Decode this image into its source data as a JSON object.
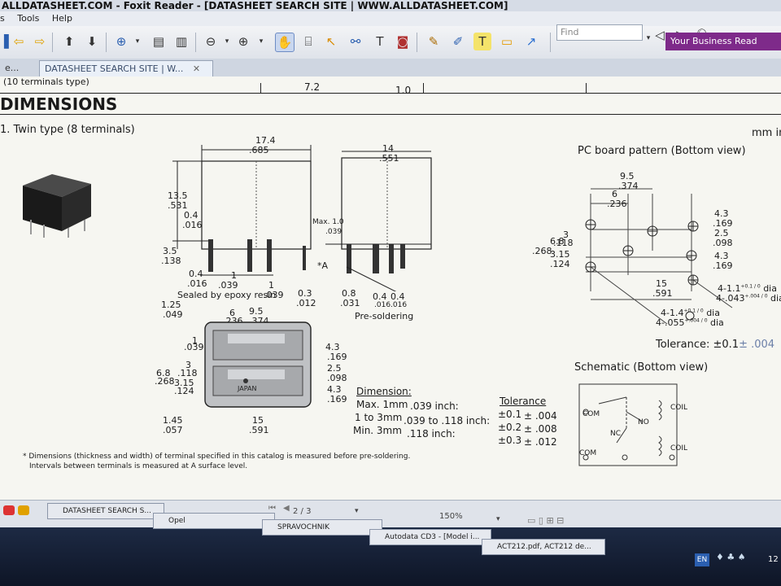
{
  "window": {
    "title": "ALLDATASHEET.COM - Foxit Reader - [DATASHEET SEARCH SITE | WWW.ALLDATASHEET.COM]"
  },
  "menu": {
    "items": [
      "s",
      "Tools",
      "Help"
    ]
  },
  "toolbar": {
    "ad_text": "Your Business Read",
    "find_placeholder": "Find"
  },
  "tabs": [
    {
      "label": "e...",
      "active": false
    },
    {
      "label": "DATASHEET SEARCH SITE | W...",
      "active": true,
      "close": "✕"
    }
  ],
  "document": {
    "table_row": {
      "left": "(10 terminals type)",
      "mid": "7.2",
      "right": "1.0"
    },
    "section_title": "DIMENSIONS",
    "subsection": "1. Twin type (8 terminals)",
    "unit": "mm in",
    "front_view": {
      "width_mm": "17.4",
      "width_in": ".685",
      "height_mm": "13.5",
      "height_in": ".531",
      "d04_mm": "0.4",
      "d04_in": ".016",
      "d35_mm": "3.5",
      "d35_in": ".138",
      "pin_w_mm": "0.4",
      "pin_w_in": ".016",
      "pitch1_mm": "1",
      "pitch1_in": ".039",
      "pitch2_mm": "1",
      "pitch2_in": ".039"
    },
    "side_view": {
      "width_mm": "14",
      "width_in": ".551",
      "max_label": "Max. 1.0",
      "max_in": ".039",
      "a_label": "*A",
      "d03_mm": "0.3",
      "d03_in": ".012",
      "d08_mm": "0.8",
      "d08_in": ".031",
      "d04a_mm": "0.4",
      "d04a_in": ".016",
      "d04b_mm": "0.4",
      "d04b_in": ".016",
      "presolder": "Pre-soldering"
    },
    "bottom_view": {
      "sealed": "Sealed by epoxy resin",
      "d125_mm": "1.25",
      "d125_in": ".049",
      "d6_mm": "6",
      "d6_in": ".236",
      "d95_mm": "9.5",
      "d95_in": ".374",
      "d1_mm": "1",
      "d1_in": ".039",
      "d3_mm": "3",
      "d3_in": ".118",
      "d68_mm": "6.8",
      "d68_in": ".268",
      "d315_mm": "3.15",
      "d315_in": ".124",
      "d43_mm": "4.3",
      "d43_in": ".169",
      "d25_mm": "2.5",
      "d25_in": ".098",
      "d43b_mm": "4.3",
      "d43b_in": ".169",
      "d145_mm": "1.45",
      "d145_in": ".057",
      "d15_mm": "15",
      "d15_in": ".591",
      "japan": "JAPAN"
    },
    "dimension_table": {
      "title": "Dimension:",
      "rows": [
        {
          "label": "Max. 1mm",
          "inch": ".039 inch:"
        },
        {
          "label": "1 to 3mm",
          "inch": ".039 to .118 inch:"
        },
        {
          "label": "Min. 3mm",
          "inch": ".118 inch:"
        }
      ]
    },
    "tolerance_table": {
      "title": "Tolerance",
      "rows": [
        {
          "mm": "±0.1",
          "in": "± .004"
        },
        {
          "mm": "±0.2",
          "in": "± .008"
        },
        {
          "mm": "±0.3",
          "in": "± .012"
        }
      ]
    },
    "pcb": {
      "title": "PC board pattern (Bottom view)",
      "d95_mm": "9.5",
      "d95_in": ".374",
      "d6_mm": "6",
      "d6_in": ".236",
      "d3_mm": "3",
      "d3_in": ".118",
      "d68_mm": "6.8",
      "d68_in": ".268",
      "d315_mm": "3.15",
      "d315_in": ".124",
      "d43_mm": "4.3",
      "d43_in": ".169",
      "d25_mm": "2.5",
      "d25_in": ".098",
      "d43b_mm": "4.3",
      "d43b_in": ".169",
      "d15_mm": "15",
      "d15_in": ".591",
      "hole1": "4-1.1",
      "hole1_tol": "+0.1 / 0",
      "hole1_suffix": "dia",
      "hole1_in": "4-.043",
      "hole1_in_tol": "+.004 / 0",
      "hole1_in_suffix": "dia",
      "hole2": "4-1.4",
      "hole2_tol": "+0.1 / 0",
      "hole2_suffix": "dia",
      "hole2_in": "4-.055",
      "hole2_in_tol": "+.004 / 0",
      "hole2_in_suffix": "dia",
      "tolerance": "Tolerance: ±0.1",
      "tolerance_in": "± .004"
    },
    "schematic": {
      "title": "Schematic (Bottom view)",
      "com1": "COM",
      "no1": "NO",
      "coil1": "COIL",
      "nc": "NC",
      "com2": "COM",
      "coil2": "COIL"
    },
    "footnote1": "* Dimensions (thickness and width) of terminal specified in this catalog is measured before pre-soldering.",
    "footnote2": "Intervals between terminals is measured at A surface level."
  },
  "statusbar": {
    "page": "2 / 3",
    "zoom": "150%"
  },
  "taskbar": {
    "items": [
      "DATASHEET SEARCH S...",
      "Opel",
      "SPRAVOCHNIK",
      "Autodata CD3 - [Model i...",
      "ACT212.pdf, ACT212 de..."
    ],
    "lang": "EN",
    "clock": "12"
  }
}
